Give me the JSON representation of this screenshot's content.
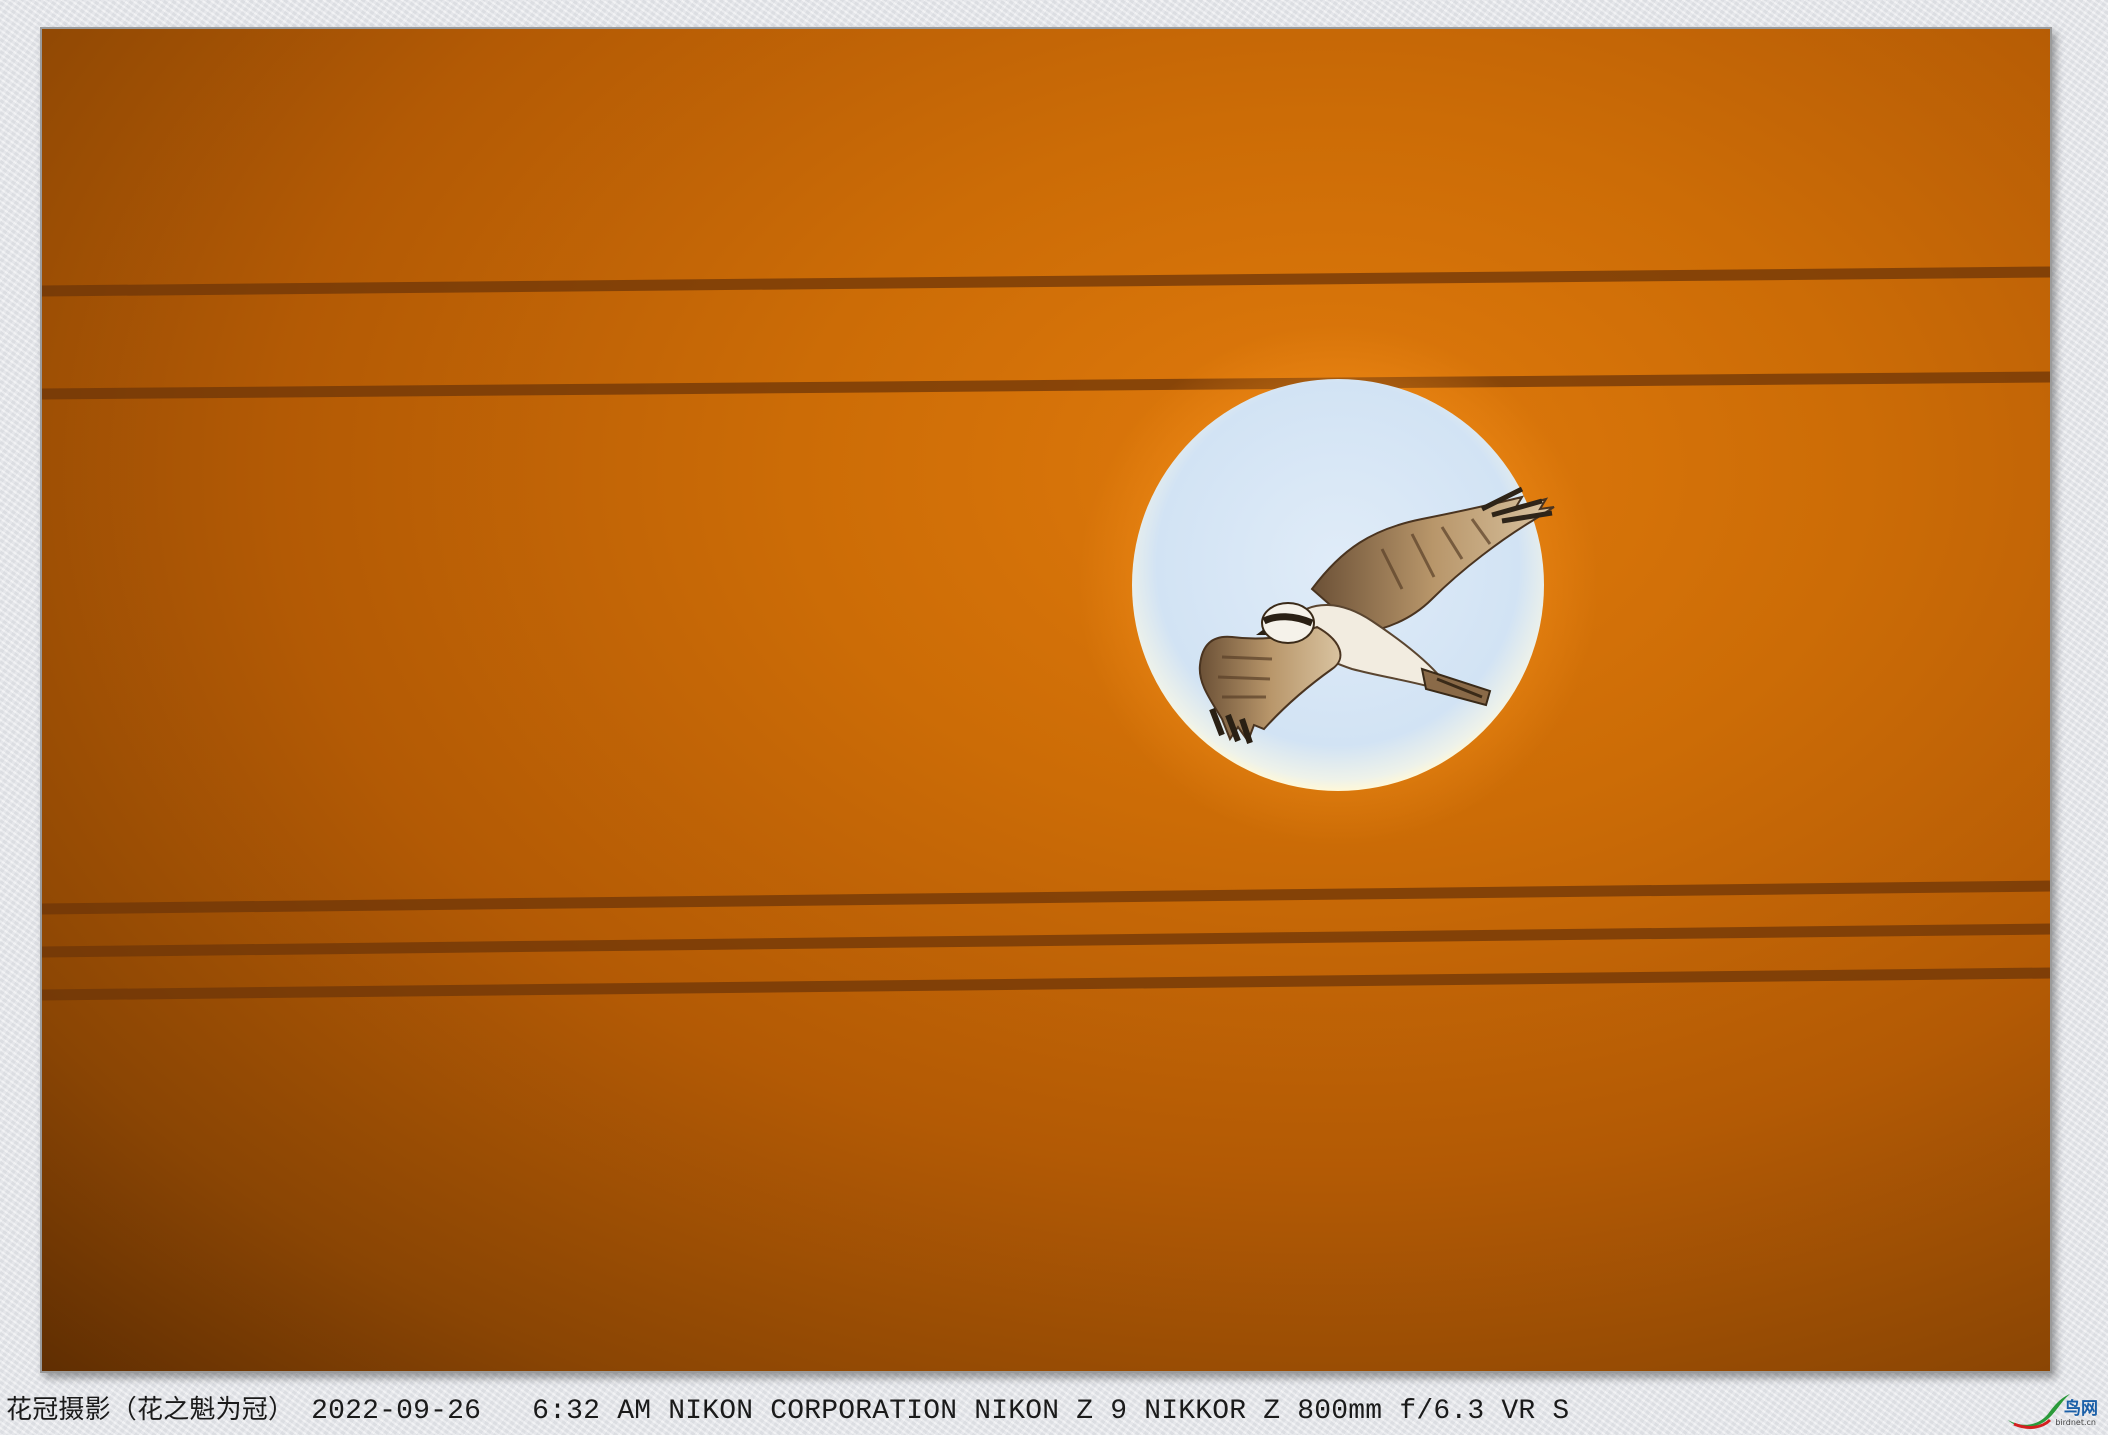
{
  "caption": {
    "author": "花冠摄影（花之魁为冠）",
    "camera_info": "2022-09-26   6:32 AM NIKON CORPORATION NIKON Z 9 NIKKOR Z 800mm f/6.3 VR S"
  },
  "watermark": {
    "brand": "鸟网",
    "site": "birdnet.cn"
  },
  "photo": {
    "subject": "osprey-in-flight-against-sun",
    "colors": {
      "sky_light": "#d5762a",
      "sky_mid": "#c4680e",
      "sky_dark": "#5a2e05",
      "sun_disc": "#d6e6f6",
      "sun_halo": "#fdf6d6",
      "wires": "#7a3c08"
    }
  }
}
